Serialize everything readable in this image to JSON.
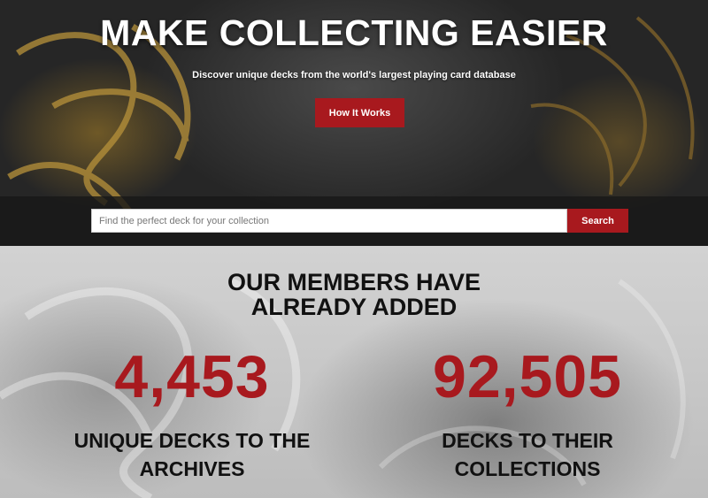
{
  "hero": {
    "title": "MAKE COLLECTING EASIER",
    "subtitle": "Discover unique decks from the world's largest playing card database",
    "cta_label": "How It Works"
  },
  "search": {
    "placeholder": "Find the perfect deck for your collection",
    "button_label": "Search"
  },
  "stats": {
    "heading_line1": "OUR MEMBERS HAVE",
    "heading_line2": "ALREADY ADDED",
    "items": [
      {
        "number": "4,453",
        "label_line1": "UNIQUE DECKS TO THE",
        "label_line2": "ARCHIVES"
      },
      {
        "number": "92,505",
        "label_line1": "DECKS TO THEIR",
        "label_line2": "COLLECTIONS"
      }
    ]
  },
  "colors": {
    "accent": "#a8191e",
    "dark_text": "#111111",
    "gold": "#b8923a"
  }
}
